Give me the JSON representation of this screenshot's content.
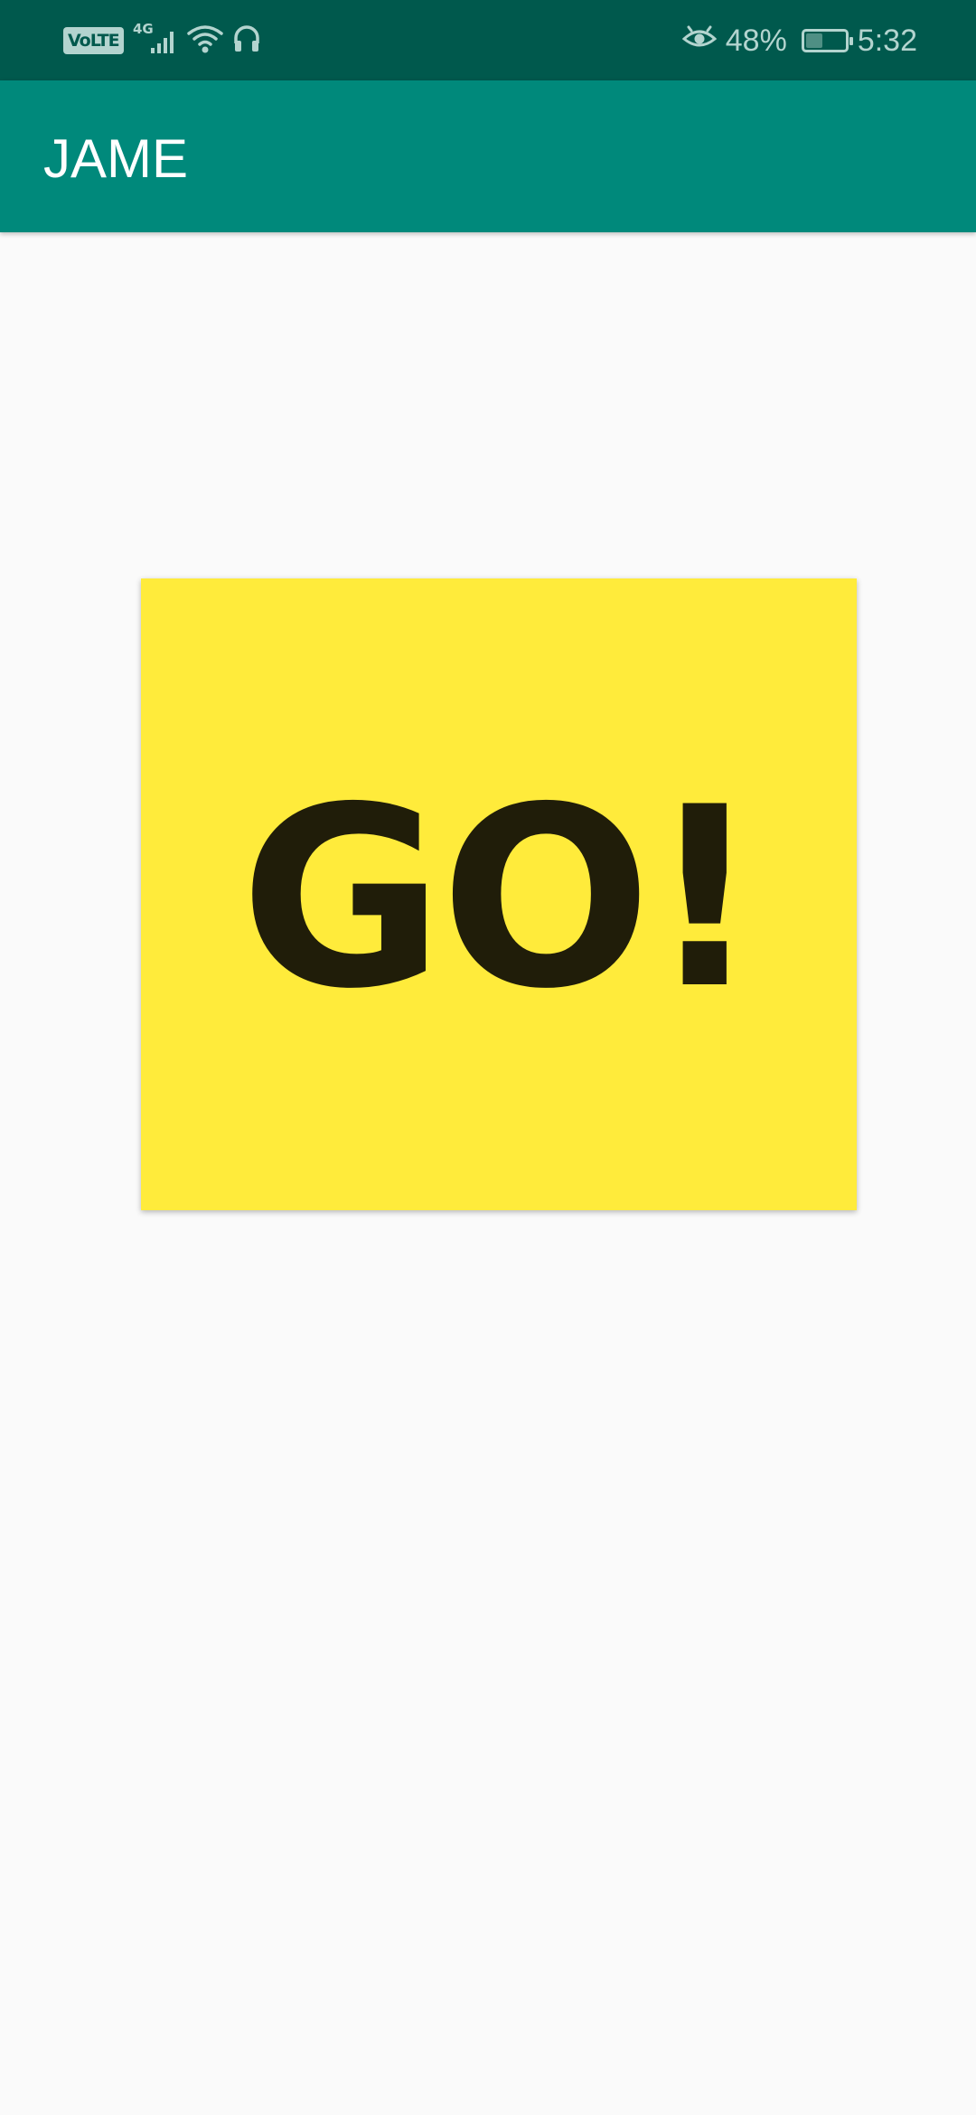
{
  "status_bar": {
    "network_badge": "VoLTE",
    "network_type": "4G",
    "icons": [
      "volte-icon",
      "signal-icon",
      "wifi-icon",
      "headset-icon",
      "eye-comfort-icon",
      "battery-icon"
    ],
    "battery_percent": "48%",
    "battery_level": 0.48,
    "time": "5:32"
  },
  "app_bar": {
    "title": "JAME",
    "color": "#00897b"
  },
  "main": {
    "go_button_label": "GO!",
    "go_button_color": "#ffeb3b"
  }
}
